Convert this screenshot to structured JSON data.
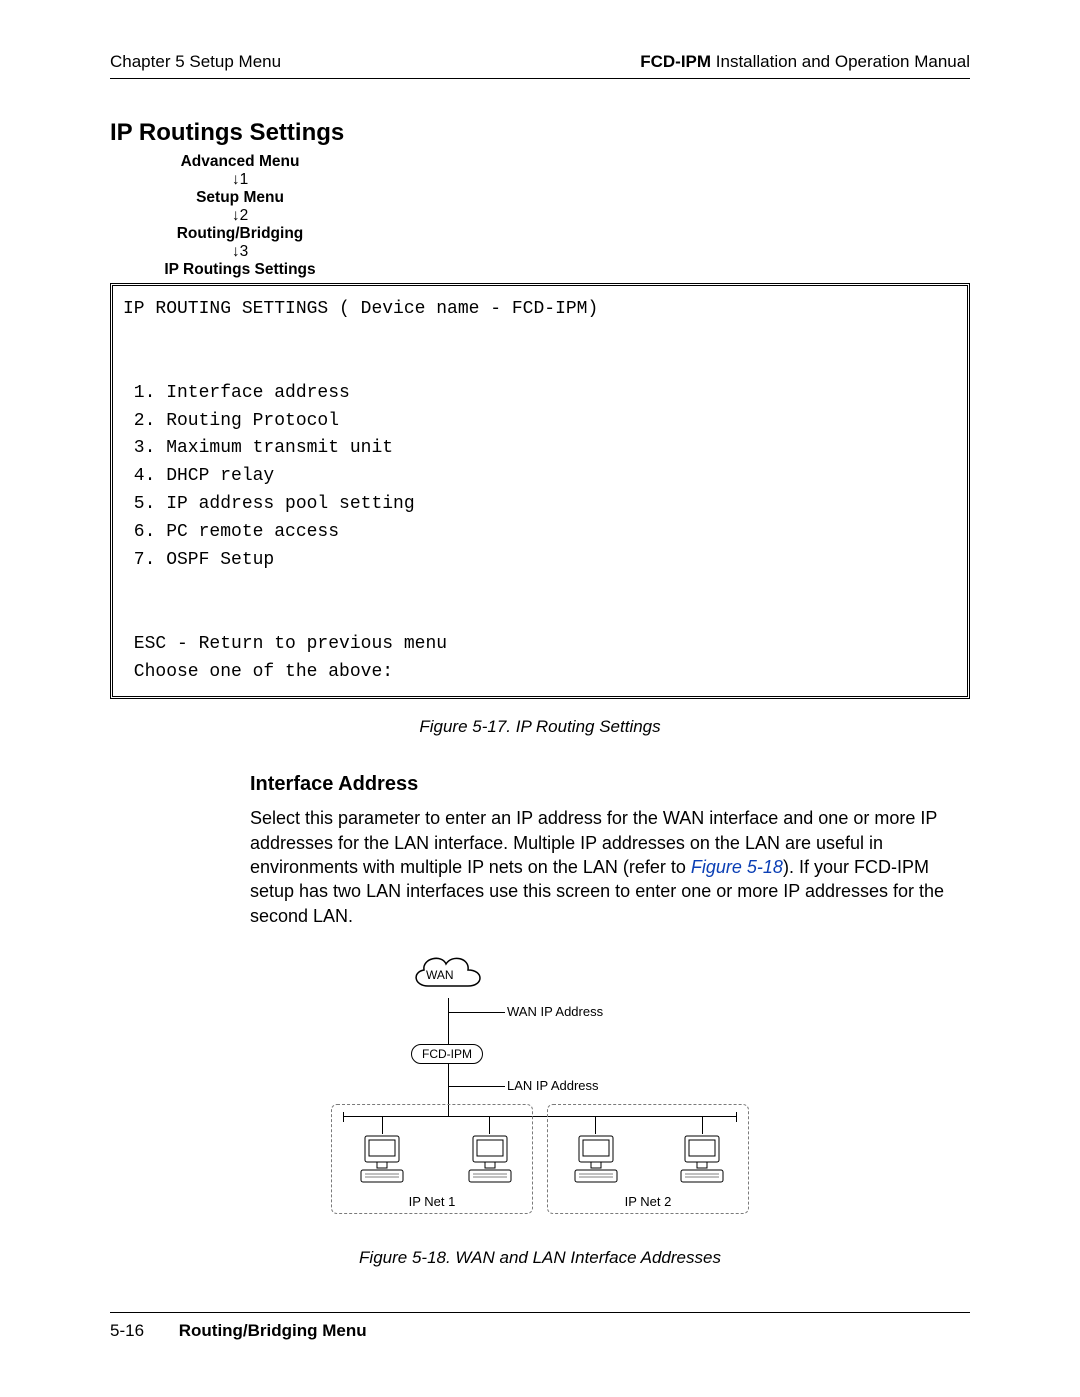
{
  "header": {
    "chapter_left": "Chapter 5  Setup Menu",
    "product": "FCD-IPM",
    "right_suffix": " Installation and Operation Manual"
  },
  "section_title": "IP Routings Settings",
  "nav": {
    "l1": "Advanced Menu",
    "a1": "↓1",
    "l2": "Setup Menu",
    "a2": "↓2",
    "l3": "Routing/Bridging",
    "a3": "↓3",
    "l4": "IP Routings Settings"
  },
  "terminal": {
    "title": "IP ROUTING SETTINGS ( Device name - FCD-IPM)",
    "items": [
      " 1. Interface address",
      " 2. Routing Protocol",
      " 3. Maximum transmit unit",
      " 4. DHCP relay",
      " 5. IP address pool setting",
      " 6. PC remote access",
      " 7. OSPF Setup"
    ],
    "esc": " ESC - Return to previous menu",
    "prompt": " Choose one of the above:"
  },
  "figure17_caption": "Figure 5-17.  IP Routing Settings",
  "subheading": "Interface Address",
  "paragraph": {
    "pre": "Select this parameter to enter an IP address for the WAN interface and one or more IP addresses for the LAN interface. Multiple IP addresses on the LAN are useful in environments with multiple IP nets on the LAN (refer to ",
    "link": "Figure 5-18",
    "post": "). If your FCD-IPM setup has two LAN interfaces use this screen to enter one or more IP addresses for the second LAN."
  },
  "diagram": {
    "cloud": "WAN",
    "wan_ip": "WAN IP Address",
    "device": "FCD-IPM",
    "lan_ip": "LAN IP Address",
    "net1": "IP Net 1",
    "net2": "IP Net 2"
  },
  "figure18_caption": "Figure 5-18.  WAN and LAN Interface Addresses",
  "footer": {
    "page": "5-16",
    "section": "Routing/Bridging Menu"
  }
}
